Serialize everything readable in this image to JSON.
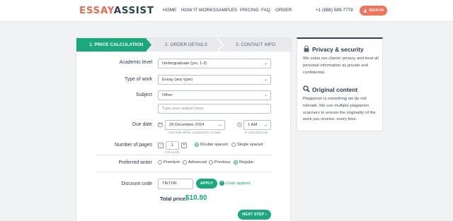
{
  "header": {
    "logo_part1": "ESSAY",
    "logo_part2": "ASSIST",
    "nav": [
      "HOME",
      "HOW IT WORKS",
      "SAMPLES",
      "PRICING",
      "FAQ",
      "ORDER"
    ],
    "phone": "+1 (888) 589-7778",
    "signin_label": "SIGN IN",
    "signin_icon": "user-icon"
  },
  "colors": {
    "accent_green": "#1aa97c",
    "accent_orange": "#ef6a4f",
    "navy": "#2d3e57"
  },
  "steps": [
    {
      "label": "1. PRICE CALCULATION",
      "active": true
    },
    {
      "label": "2. ORDER DETAILS",
      "active": false
    },
    {
      "label": "3. CONTACT INFO",
      "active": false
    }
  ],
  "form": {
    "academic_level": {
      "label": "Academic level",
      "value": "Undergraduate (yrs. 1-2)"
    },
    "type_of_work": {
      "label": "Type of work",
      "value": "Essay (any type)"
    },
    "subject": {
      "label": "Subject",
      "value": "Other",
      "custom_placeholder": "Type your subject here"
    },
    "due_date": {
      "label": "Due date",
      "date": "26 December 2024",
      "date_hint": "Your task will be completed in 14 days",
      "time": "1 AM",
      "time_hint": "In your timezone"
    },
    "pages": {
      "label": "Number of pages",
      "minus": "−",
      "value": "1",
      "plus": "+",
      "words_hint": "275 words",
      "spacing_options": [
        {
          "label": "Double spaced",
          "selected": true
        },
        {
          "label": "Single spaced",
          "selected": false
        }
      ]
    },
    "writer": {
      "label": "Preferred writer",
      "options": [
        {
          "label": "Premium",
          "selected": false
        },
        {
          "label": "Advanced",
          "selected": false
        },
        {
          "label": "Previous",
          "selected": false
        },
        {
          "label": "Regular",
          "selected": true
        }
      ]
    },
    "discount": {
      "label": "Discount code",
      "value": "TIKTOK",
      "apply_label": "APPLY",
      "applied_text": "Code applied"
    },
    "total": {
      "label": "Total price:",
      "value": "$10.80"
    },
    "next_label": "NEXT STEP ›"
  },
  "sidebar": {
    "privacy_icon": "lock-icon",
    "privacy_title": "Privacy & security",
    "privacy_text": "We value our clients' privacy and treat all personal information as private and confidential.",
    "original_icon": "magnifier-icon",
    "original_title": "Original content",
    "original_text": "Plagiarism is something we do not tolerate. We use multiple plagiarism scanners to ensure the originality of the work you receive, every time."
  }
}
